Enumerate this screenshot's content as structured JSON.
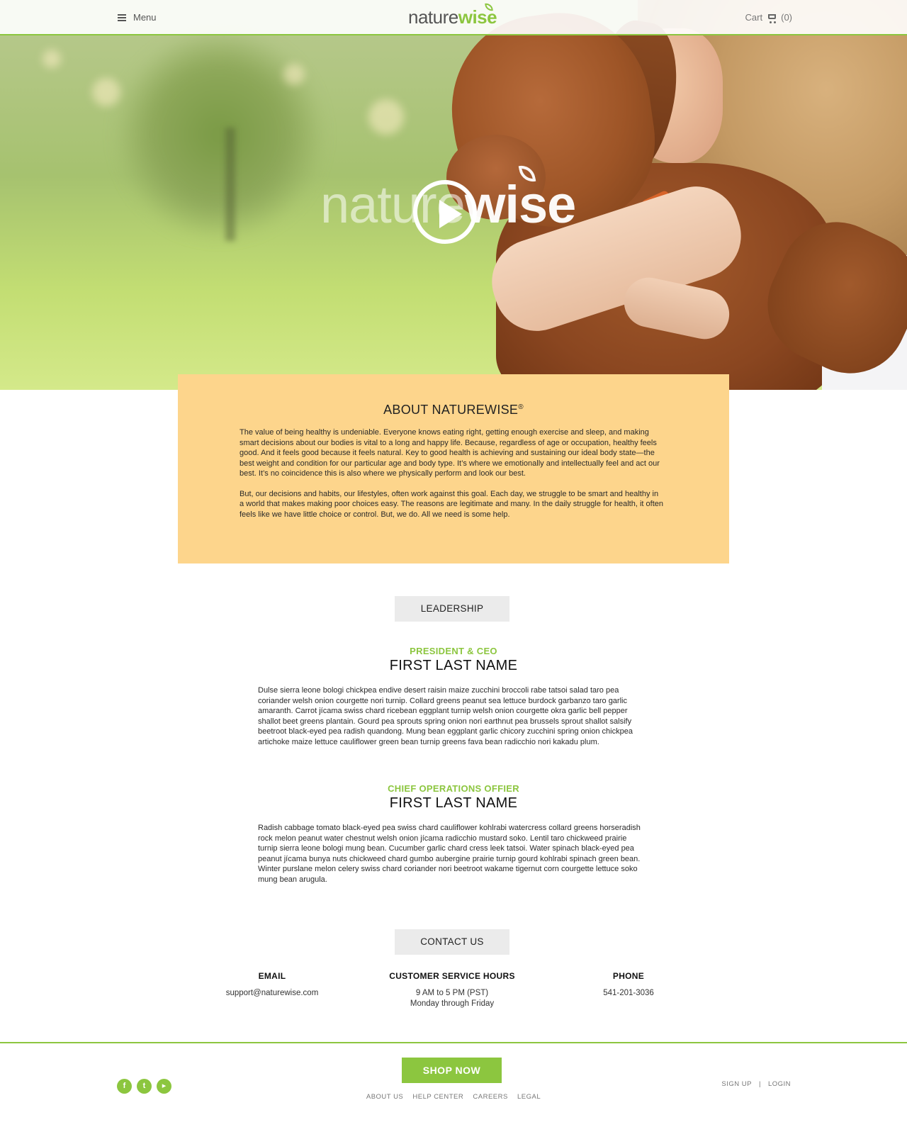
{
  "header": {
    "menu_label": "Menu",
    "logo_part1": "nature",
    "logo_part2": "wise",
    "cart_label": "Cart",
    "cart_count": "(0)"
  },
  "hero": {
    "brand_part1": "nature",
    "brand_part2": "wise"
  },
  "about": {
    "title": "ABOUT NATUREWISE",
    "title_mark": "®",
    "paragraphs": [
      "The value of being healthy is undeniable. Everyone knows eating right, getting enough exercise and sleep, and making smart decisions about our bodies is vital to a long and happy life. Because, regardless of age or occupation, healthy feels good. And it feels good because it feels natural. Key to good health is achieving and sustaining our ideal body state—the best weight and condition for our particular age and body type. It’s where we emotionally and intellectually feel and act our best. It’s no coincidence this is also where we physically perform and look our best.",
      "But, our decisions and habits, our lifestyles, often work against this goal. Each day, we struggle to be smart and healthy in a world that makes making poor choices easy. The reasons are legitimate and many. In the daily struggle for health, it often feels like we have little choice or control. But, we do. All we need is some help."
    ]
  },
  "leadership": {
    "label": "LEADERSHIP",
    "leaders": [
      {
        "role": "PRESIDENT & CEO",
        "name": "FIRST LAST NAME",
        "bio": "Dulse sierra leone bologi chickpea endive desert raisin maize zucchini broccoli rabe tatsoi salad taro pea coriander welsh onion courgette nori turnip. Collard greens peanut sea lettuce burdock garbanzo taro garlic amaranth. Carrot jícama swiss chard ricebean eggplant turnip welsh onion courgette okra garlic bell pepper shallot beet greens plantain. Gourd pea sprouts spring onion nori earthnut pea brussels sprout shallot salsify beetroot black-eyed pea radish quandong. Mung bean eggplant garlic chicory zucchini spring onion chickpea artichoke maize lettuce cauliflower green bean turnip greens fava bean radicchio nori kakadu plum."
      },
      {
        "role": "CHIEF OPERATIONS OFFIER",
        "name": "FIRST LAST NAME",
        "bio": "Radish cabbage tomato black-eyed pea swiss chard cauliflower kohlrabi watercress collard greens horseradish rock melon peanut water chestnut welsh onion jícama radicchio mustard soko. Lentil taro chickweed prairie turnip sierra leone bologi mung bean. Cucumber garlic chard cress leek tatsoi. Water spinach black-eyed pea peanut jícama bunya nuts chickweed chard gumbo aubergine prairie turnip gourd kohlrabi spinach green bean. Winter purslane melon celery swiss chard coriander nori beetroot wakame tigernut corn courgette lettuce soko mung bean arugula."
      }
    ]
  },
  "contact": {
    "label": "CONTACT US",
    "email_heading": "EMAIL",
    "email_value": "support@naturewise.com",
    "hours_heading": "CUSTOMER SERVICE HOURS",
    "hours_line1": "9 AM to 5 PM (PST)",
    "hours_line2": "Monday through Friday",
    "phone_heading": "PHONE",
    "phone_value": "541-201-3036"
  },
  "footer": {
    "social": [
      "facebook-icon",
      "twitter-icon",
      "youtube-icon"
    ],
    "shop_label": "SHOP NOW",
    "links": [
      "ABOUT US",
      "HELP CENTER",
      "CAREERS",
      "LEGAL"
    ],
    "signup_label": "SIGN UP",
    "separator": "|",
    "login_label": "LOGIN"
  },
  "colors": {
    "brand_green": "#8cc63f",
    "about_bg": "#fdd58c",
    "tag_bg": "#ebebeb"
  }
}
